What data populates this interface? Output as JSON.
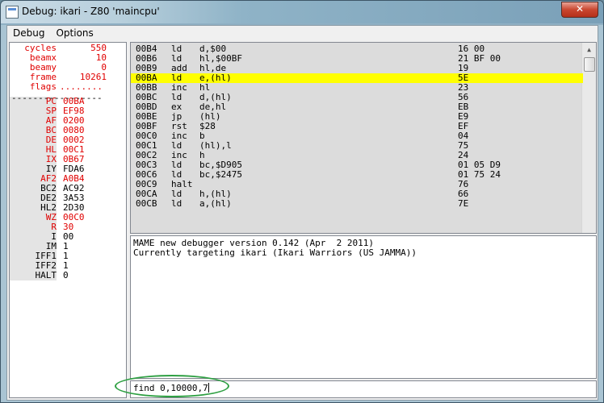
{
  "window": {
    "title": "Debug: ikari - Z80 'maincpu'",
    "close_label": "✕"
  },
  "menu": [
    "Debug",
    "Options"
  ],
  "registers": [
    {
      "name": "cycles",
      "value": "550",
      "red": true
    },
    {
      "name": "beamx",
      "value": "10",
      "red": true
    },
    {
      "name": "beamy",
      "value": "0",
      "red": true
    },
    {
      "name": "frame",
      "value": "10261",
      "red": true
    },
    {
      "name": "flags",
      "value": "........",
      "red": true
    },
    {
      "name": "PC",
      "value": "00BA",
      "red": true
    },
    {
      "name": "SP",
      "value": "EF98",
      "red": true
    },
    {
      "name": "AF",
      "value": "0200",
      "red": true
    },
    {
      "name": "BC",
      "value": "0080",
      "red": true
    },
    {
      "name": "DE",
      "value": "0002",
      "red": true
    },
    {
      "name": "HL",
      "value": "00C1",
      "red": true
    },
    {
      "name": "IX",
      "value": "0B67",
      "red": true
    },
    {
      "name": "IY",
      "value": "FDA6",
      "red": false
    },
    {
      "name": "AF2",
      "value": "A0B4",
      "red": true
    },
    {
      "name": "BC2",
      "value": "AC92",
      "red": false
    },
    {
      "name": "DE2",
      "value": "3A53",
      "red": false
    },
    {
      "name": "HL2",
      "value": "2D30",
      "red": false
    },
    {
      "name": "WZ",
      "value": "00C0",
      "red": true
    },
    {
      "name": "R",
      "value": "30",
      "red": true
    },
    {
      "name": "I",
      "value": "00",
      "red": false
    },
    {
      "name": "IM",
      "value": "1",
      "red": false
    },
    {
      "name": "IFF1",
      "value": "1",
      "red": false
    },
    {
      "name": "IFF2",
      "value": "1",
      "red": false
    },
    {
      "name": "HALT",
      "value": "0",
      "red": false
    }
  ],
  "separator": "-----------------",
  "disassembly": [
    {
      "addr": "00B4",
      "mnem": "ld",
      "ops": "d,$00",
      "bytes": "16 00",
      "highlight": false
    },
    {
      "addr": "00B6",
      "mnem": "ld",
      "ops": "hl,$00BF",
      "bytes": "21 BF 00",
      "highlight": false
    },
    {
      "addr": "00B9",
      "mnem": "add",
      "ops": "hl,de",
      "bytes": "19",
      "highlight": false
    },
    {
      "addr": "00BA",
      "mnem": "ld",
      "ops": "e,(hl)",
      "bytes": "5E",
      "highlight": true
    },
    {
      "addr": "00BB",
      "mnem": "inc",
      "ops": "hl",
      "bytes": "23",
      "highlight": false
    },
    {
      "addr": "00BC",
      "mnem": "ld",
      "ops": "d,(hl)",
      "bytes": "56",
      "highlight": false
    },
    {
      "addr": "00BD",
      "mnem": "ex",
      "ops": "de,hl",
      "bytes": "EB",
      "highlight": false
    },
    {
      "addr": "00BE",
      "mnem": "jp",
      "ops": "(hl)",
      "bytes": "E9",
      "highlight": false
    },
    {
      "addr": "00BF",
      "mnem": "rst",
      "ops": "$28",
      "bytes": "EF",
      "highlight": false
    },
    {
      "addr": "00C0",
      "mnem": "inc",
      "ops": "b",
      "bytes": "04",
      "highlight": false
    },
    {
      "addr": "00C1",
      "mnem": "ld",
      "ops": "(hl),l",
      "bytes": "75",
      "highlight": false
    },
    {
      "addr": "00C2",
      "mnem": "inc",
      "ops": "h",
      "bytes": "24",
      "highlight": false
    },
    {
      "addr": "00C3",
      "mnem": "ld",
      "ops": "bc,$D905",
      "bytes": "01 05 D9",
      "highlight": false
    },
    {
      "addr": "00C6",
      "mnem": "ld",
      "ops": "bc,$2475",
      "bytes": "01 75 24",
      "highlight": false
    },
    {
      "addr": "00C9",
      "mnem": "halt",
      "ops": "",
      "bytes": "76",
      "highlight": false
    },
    {
      "addr": "00CA",
      "mnem": "ld",
      "ops": "h,(hl)",
      "bytes": "66",
      "highlight": false
    },
    {
      "addr": "00CB",
      "mnem": "ld",
      "ops": "a,(hl)",
      "bytes": "7E",
      "highlight": false
    }
  ],
  "console_lines": [
    "MAME new debugger version 0.142 (Apr  2 2011)",
    "Currently targeting ikari (Ikari Warriors (US JAMMA))"
  ],
  "command": {
    "value": "find 0,10000,7"
  },
  "colors": {
    "highlight": "#ffff00",
    "changed_register": "#e00000",
    "annotation_oval": "#2fa043"
  }
}
